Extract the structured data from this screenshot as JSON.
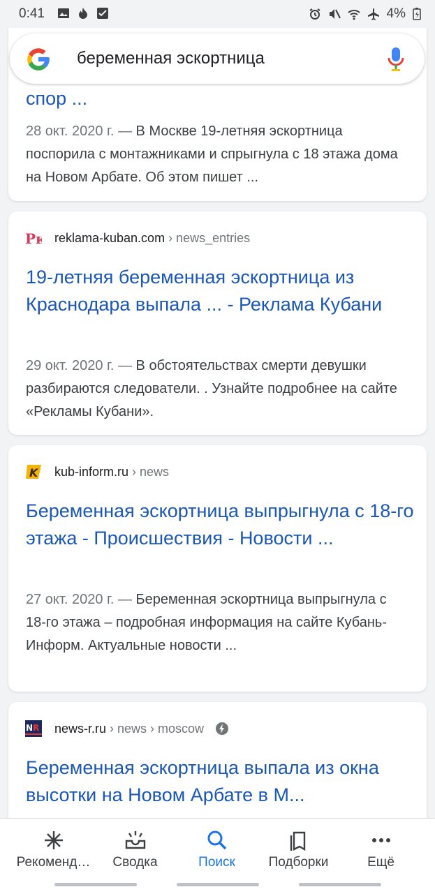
{
  "status": {
    "time": "0:41",
    "battery": "4%"
  },
  "search": {
    "query": "беременная эскортница"
  },
  "results": [
    {
      "title": "спор ...",
      "date": "28 окт. 2020 г. —",
      "snippet": "В Москве 19-летняя эскортница поспорила с монтажниками и спрыгнула с 18 этажа дома на Новом Арбате. Об этом пишет ..."
    },
    {
      "site": "reklama-kuban.com",
      "path": "› news_entries",
      "favicon": "rk-logo",
      "title": "19-летняя беременная эскортница из Краснодара выпала ... - Реклама Кубани",
      "date": "29 окт. 2020 г. —",
      "snippet": "В обстоятельствах смерти девушки разбираются следователи. . Узнайте подробнее на сайте «Рекламы Кубани»."
    },
    {
      "site": "kub-inform.ru",
      "path": "› news",
      "favicon": "k-logo",
      "title": "Беременная эскортница выпрыгнула с 18-го этажа - Происшествия - Новости ...",
      "date": "27 окт. 2020 г. —",
      "snippet": "Беременная эскортница выпрыгнула с 18-го этажа – подробная информация на сайте Кубань-Информ. Актуальные новости ..."
    },
    {
      "site": "news-r.ru",
      "path": "› news › moscow",
      "favicon": "nr-logo",
      "title": "Беременная эскортница выпала из окна высотки на Новом Арбате в М..."
    }
  ],
  "nav": {
    "items": [
      {
        "label": "Рекоменд…",
        "icon": "sparkle-icon"
      },
      {
        "label": "Сводка",
        "icon": "inbox-icon"
      },
      {
        "label": "Поиск",
        "icon": "search-icon"
      },
      {
        "label": "Подборки",
        "icon": "collections-icon"
      },
      {
        "label": "Ещё",
        "icon": "more-icon"
      }
    ]
  },
  "colors": {
    "link": "#1a57b7",
    "accent": "#1a73e8",
    "background": "#f1f3f4"
  }
}
